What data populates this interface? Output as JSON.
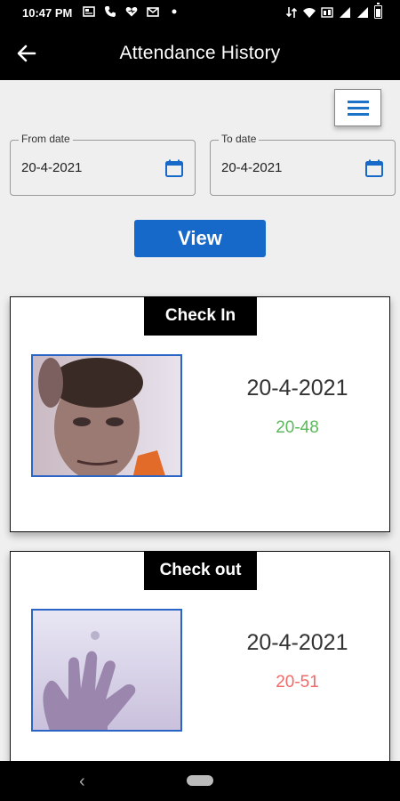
{
  "status_bar": {
    "time": "10:47 PM"
  },
  "app_bar": {
    "title": "Attendance History"
  },
  "filters": {
    "from_label": "From date",
    "from_value": "20-4-2021",
    "to_label": "To date",
    "to_value": "20-4-2021",
    "view_label": "View"
  },
  "cards": [
    {
      "label": "Check In",
      "date": "20-4-2021",
      "time": "20-48",
      "time_color": "#5cb85c"
    },
    {
      "label": "Check out",
      "date": "20-4-2021",
      "time": "20-51",
      "time_color": "#f06a6a"
    }
  ],
  "colors": {
    "accent": "#1769c9",
    "bars": "#000000"
  }
}
